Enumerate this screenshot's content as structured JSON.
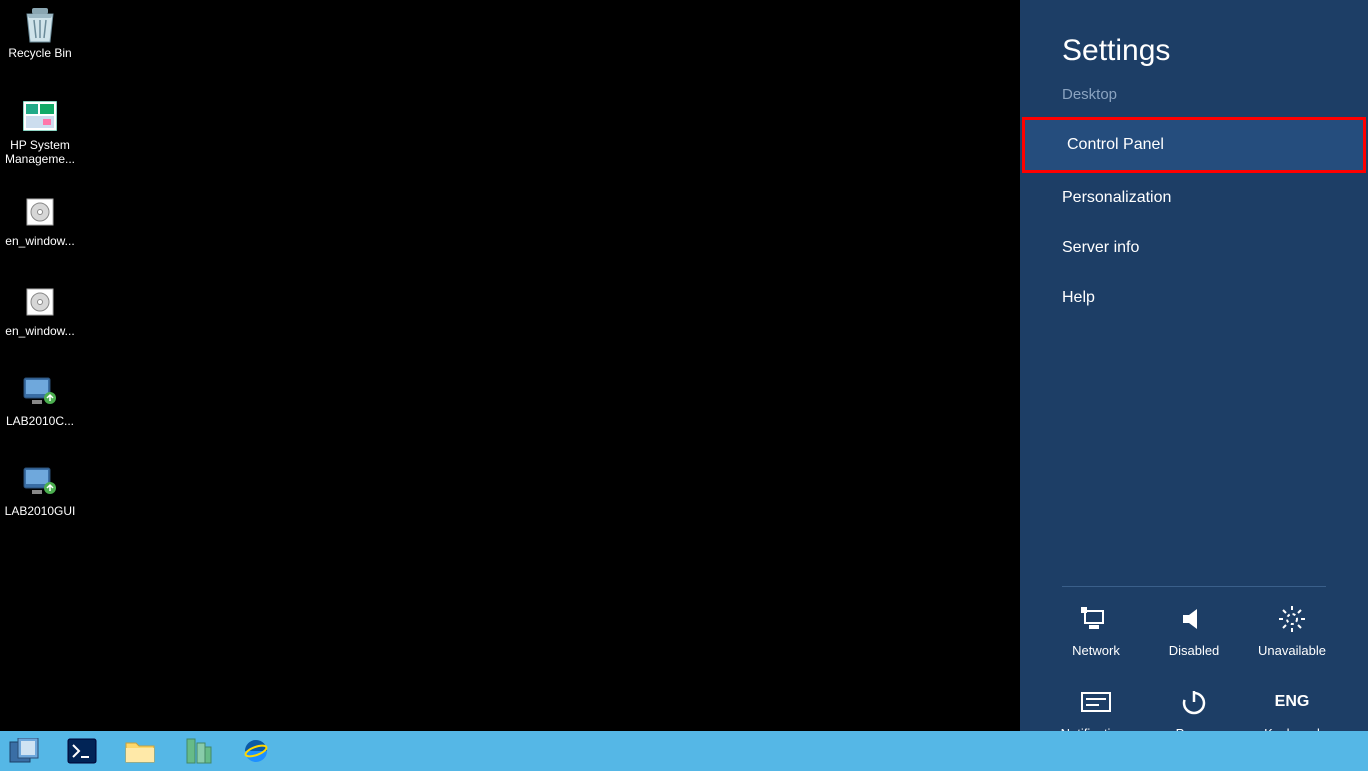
{
  "desktop_icons": [
    {
      "id": "recycle-bin",
      "label": "Recycle Bin"
    },
    {
      "id": "hp-system-management",
      "label": "HP System Manageme..."
    },
    {
      "id": "en-window-1",
      "label": "en_window..."
    },
    {
      "id": "en-window-2",
      "label": "en_window..."
    },
    {
      "id": "lab2010c",
      "label": "LAB2010C..."
    },
    {
      "id": "lab2010gui",
      "label": "LAB2010GUI"
    }
  ],
  "settings": {
    "title": "Settings",
    "context": "Desktop",
    "items": [
      {
        "id": "control-panel",
        "label": "Control Panel",
        "highlighted": true
      },
      {
        "id": "personalization",
        "label": "Personalization"
      },
      {
        "id": "server-info",
        "label": "Server info"
      },
      {
        "id": "help",
        "label": "Help"
      }
    ],
    "tiles": [
      {
        "id": "network",
        "label": "Network"
      },
      {
        "id": "volume",
        "label": "Disabled"
      },
      {
        "id": "brightness",
        "label": "Unavailable"
      },
      {
        "id": "notifications",
        "label": "Notifications"
      },
      {
        "id": "power",
        "label": "Power"
      },
      {
        "id": "keyboard",
        "label": "Keyboard",
        "big": "ENG"
      }
    ]
  },
  "taskbar": {
    "items": [
      "server-manager",
      "powershell",
      "file-explorer",
      "iis",
      "internet-explorer"
    ]
  }
}
